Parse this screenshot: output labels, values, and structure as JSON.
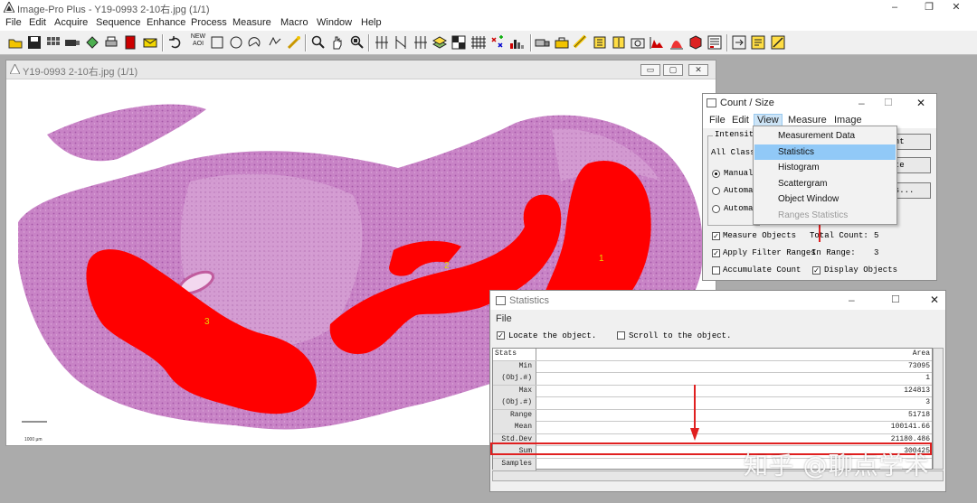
{
  "app": {
    "title": "Image-Pro Plus - Y19-0993  2-10右.jpg (1/1)",
    "menu": [
      "File",
      "Edit",
      "Acquire",
      "Sequence",
      "Enhance",
      "Process",
      "Measure",
      "Macro",
      "Window",
      "Help"
    ],
    "window_controls": [
      "–",
      "❐",
      "✕"
    ]
  },
  "toolbar": {
    "new_aoi_label_1": "NEW",
    "new_aoi_label_2": "AOI",
    "icons": [
      "open-icon",
      "save-icon",
      "grid-icon",
      "camera-icon",
      "lasso-icon",
      "print-icon",
      "book-icon",
      "mail-icon",
      "undo-icon",
      "rectangle-icon",
      "ellipse-icon",
      "polygon-icon",
      "freehand-icon",
      "wand-icon",
      "zoom-icon",
      "hand-icon",
      "zoom-fit-icon",
      "line-profile-icon",
      "bar-tool-icon",
      "grid-tool-icon",
      "layers-icon",
      "matrix-icon",
      "points-icon",
      "color-count-icon",
      "histogram-icon",
      "truck-icon",
      "calibrate-icon",
      "ruler-icon",
      "camera2-icon",
      "histo2-icon",
      "hist3-icon",
      "cube-icon",
      "tally-icon",
      "export-icon",
      "report-icon",
      "settings-icon"
    ]
  },
  "image_window": {
    "title": "Y19-0993  2-10右.jpg (1/1)",
    "controls": [
      "▭",
      "▢",
      "✕"
    ],
    "object_labels": [
      "1",
      "2",
      "3"
    ],
    "scale_text": "1000 μm"
  },
  "count_dialog": {
    "title": "Count / Size",
    "menu": [
      "File",
      "Edit",
      "View",
      "Measure",
      "Image"
    ],
    "active_menu": "View",
    "intensity_label": "Intensity",
    "all_classes": "All Classe",
    "radios": [
      {
        "label": "Manual:",
        "checked": true
      },
      {
        "label": "Automat",
        "checked": false
      },
      {
        "label": "Automat",
        "checked": false
      }
    ],
    "buttons": [
      "ount",
      "lete",
      "ons..."
    ],
    "measure_objects": "Measure Objects",
    "apply_filter": "Apply Filter Ranges",
    "accumulate": "Accumulate Count",
    "display_objects": "Display Objects",
    "total_count_label": "Total Count:",
    "total_count": "5",
    "in_range_label": "In Range:",
    "in_range": "3",
    "controls": [
      "–",
      "☐",
      "✕"
    ]
  },
  "view_menu": {
    "items": [
      {
        "label": "Measurement Data",
        "state": "normal"
      },
      {
        "label": "Statistics",
        "state": "highlighted"
      },
      {
        "label": "Histogram",
        "state": "normal"
      },
      {
        "label": "Scattergram",
        "state": "normal"
      },
      {
        "label": "Object Window",
        "state": "normal"
      },
      {
        "label": "Ranges Statistics",
        "state": "disabled"
      }
    ]
  },
  "stats_dialog": {
    "title": "Statistics",
    "menu": "File",
    "locate": "Locate the object.",
    "scroll": "Scroll to the object.",
    "header": {
      "label": "Stats",
      "column": "Area"
    },
    "rows": [
      {
        "label": "Min",
        "value": "73095"
      },
      {
        "label": "(Obj.#)",
        "value": "1"
      },
      {
        "label": "Max",
        "value": "124813"
      },
      {
        "label": "(Obj.#)",
        "value": "3"
      },
      {
        "label": "Range",
        "value": "51718"
      },
      {
        "label": "Mean",
        "value": "100141.66"
      },
      {
        "label": "Std.Dev",
        "value": "21180.486"
      },
      {
        "label": "Sum",
        "value": "300425"
      },
      {
        "label": "Samples",
        "value": ""
      }
    ],
    "controls": [
      "–",
      "☐",
      "✕"
    ]
  },
  "colors": {
    "highlight_red": "#e02020",
    "menu_highlight": "#91c9f7",
    "tissue": "#c77bc4",
    "object_red": "#ff0000"
  },
  "watermark": "知乎 @聊点学术"
}
